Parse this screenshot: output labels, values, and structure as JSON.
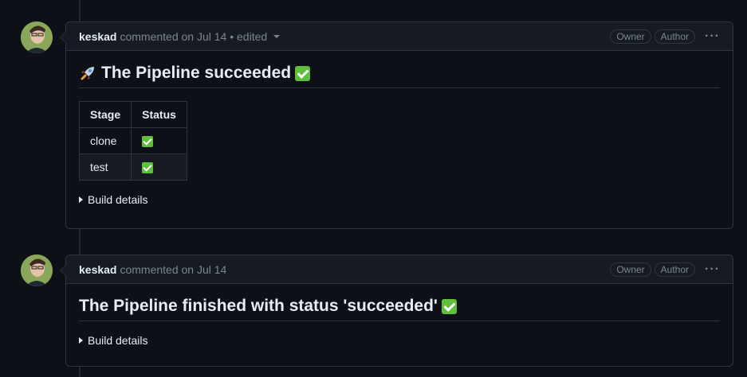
{
  "comments": [
    {
      "author": "keskad",
      "meta": "commented on Jul 14 • edited",
      "badges": [
        "Owner",
        "Author"
      ],
      "title": "The Pipeline succeeded",
      "table": {
        "headers": [
          "Stage",
          "Status"
        ],
        "rows": [
          {
            "stage": "clone",
            "status_icon": "check-emoji"
          },
          {
            "stage": "test",
            "status_icon": "check-emoji"
          }
        ]
      },
      "details_label": "Build details"
    },
    {
      "author": "keskad",
      "meta": "commented on Jul 14",
      "badges": [
        "Owner",
        "Author"
      ],
      "title": "The Pipeline finished with status 'succeeded'",
      "details_label": "Build details"
    }
  ],
  "icons": {
    "rocket": "rocket-icon",
    "check": "check-emoji",
    "kebab": "kebab-menu-icon"
  },
  "colors": {
    "background": "#0d1117",
    "header": "#161b22",
    "border": "#30363d",
    "muted": "#7d8590",
    "check": "#5fbf3d"
  }
}
